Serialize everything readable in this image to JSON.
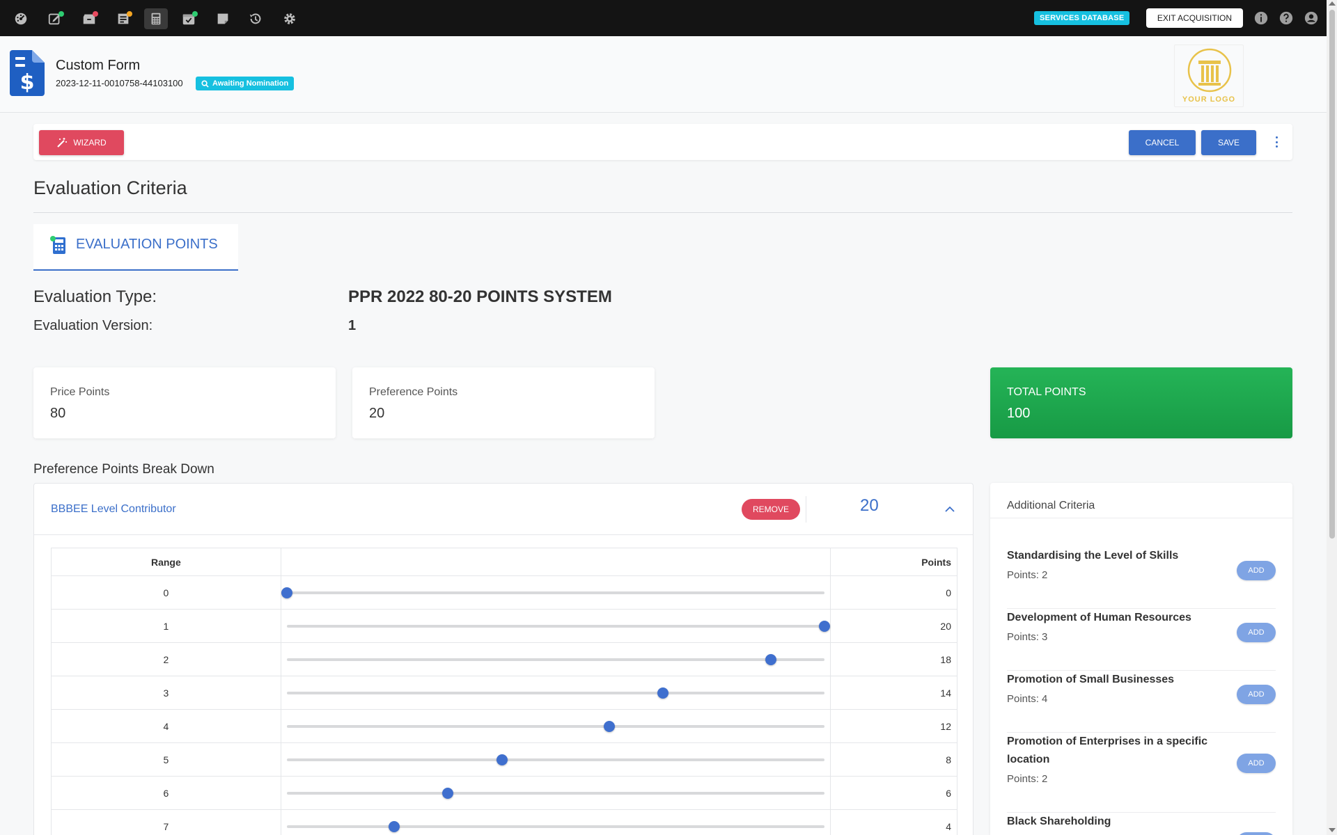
{
  "topbar": {
    "nav_icons": [
      "dashboard-icon",
      "edit-icon",
      "inbox-icon",
      "orders-icon",
      "calculator-icon",
      "calendar-check-icon",
      "notes-icon",
      "history-icon",
      "settings-icon"
    ],
    "services_label": "SERVICES DATABASE",
    "exit_label": "EXIT ACQUISITION",
    "right_icons": [
      "info-icon",
      "help-icon",
      "account-icon"
    ]
  },
  "header": {
    "title": "Custom Form",
    "form_id": "2023-12-11-0010758-44103100",
    "status": "Awaiting Nomination",
    "logo_text": "YOUR LOGO"
  },
  "toolbar": {
    "wizard_label": "WIZARD",
    "cancel_label": "CANCEL",
    "save_label": "SAVE"
  },
  "section": {
    "title": "Evaluation Criteria",
    "tab_label": "EVALUATION POINTS"
  },
  "evaluation": {
    "type_label": "Evaluation Type:",
    "type_value": "PPR 2022 80-20 POINTS SYSTEM",
    "version_label": "Evaluation Version:",
    "version_value": "1"
  },
  "cards": {
    "price_label": "Price Points",
    "price_value": "80",
    "preference_label": "Preference Points",
    "preference_value": "20",
    "total_label": "TOTAL POINTS",
    "total_value": "100"
  },
  "breakdown": {
    "title": "Preference Points Break Down",
    "criterion": "BBBEE Level Contributor",
    "remove_label": "REMOVE",
    "criterion_points": "20",
    "col_range": "Range",
    "col_points": "Points",
    "max_points": 20,
    "rows": [
      {
        "range": "0",
        "points": "0"
      },
      {
        "range": "1",
        "points": "20"
      },
      {
        "range": "2",
        "points": "18"
      },
      {
        "range": "3",
        "points": "14"
      },
      {
        "range": "4",
        "points": "12"
      },
      {
        "range": "5",
        "points": "8"
      },
      {
        "range": "6",
        "points": "6"
      },
      {
        "range": "7",
        "points": "4"
      }
    ]
  },
  "additional": {
    "title": "Additional Criteria",
    "add_label": "ADD",
    "items": [
      {
        "name": "Standardising the Level of Skills",
        "points": "Points: 2"
      },
      {
        "name": "Development of Human Resources",
        "points": "Points: 3"
      },
      {
        "name": "Promotion of Small Businesses",
        "points": "Points: 4"
      },
      {
        "name": "Promotion of Enterprises in a specific location",
        "points": "Points: 2"
      },
      {
        "name": "Black Shareholding",
        "points": ""
      }
    ]
  },
  "colors": {
    "primary": "#3b6fc9",
    "danger": "#e0495f",
    "success": "#1daa4f",
    "info": "#16c0e0",
    "topbar": "#141414"
  }
}
